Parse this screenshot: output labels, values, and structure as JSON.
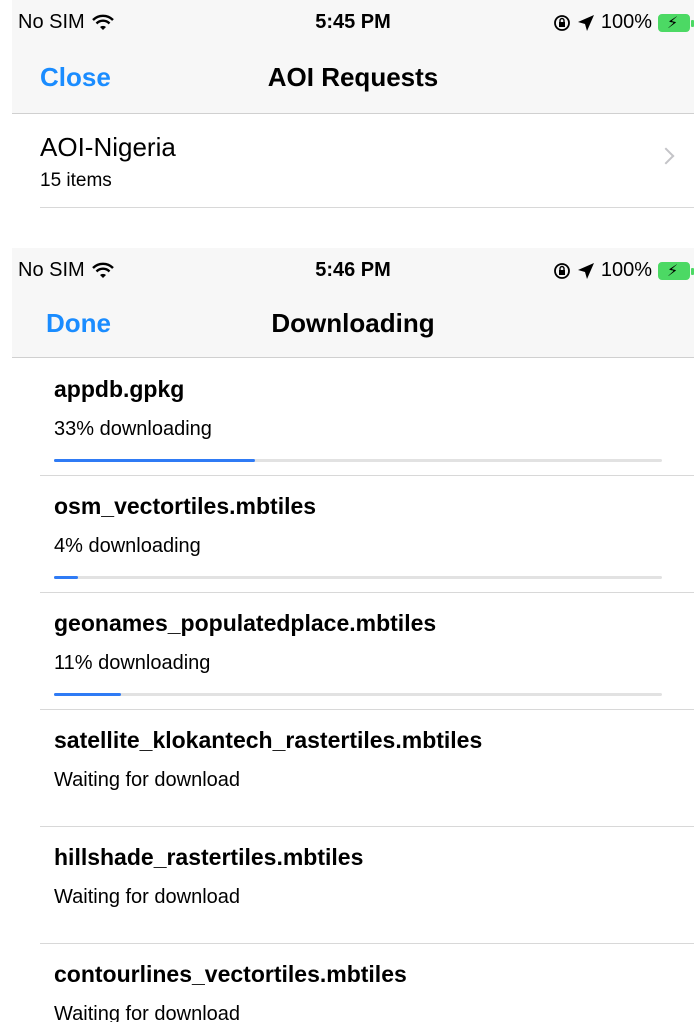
{
  "background_sheet": {
    "status_bar": {
      "carrier": "No SIM",
      "time": "5:45 PM",
      "battery": "100%"
    },
    "nav": {
      "left_button": "Close",
      "title": "AOI Requests"
    },
    "aoi_row": {
      "name": "AOI-Nigeria",
      "count": "15 items"
    }
  },
  "downloading_sheet": {
    "status_bar": {
      "carrier": "No SIM",
      "time": "5:46 PM",
      "battery": "100%"
    },
    "nav": {
      "left_button": "Done",
      "title": "Downloading"
    },
    "items": [
      {
        "name": "appdb.gpkg",
        "status": "33% downloading",
        "progress": 0.33
      },
      {
        "name": "osm_vectortiles.mbtiles",
        "status": "4% downloading",
        "progress": 0.04
      },
      {
        "name": "geonames_populatedplace.mbtiles",
        "status": "11% downloading",
        "progress": 0.11
      },
      {
        "name": "satellite_klokantech_rastertiles.mbtiles",
        "status": "Waiting for download",
        "progress": null
      },
      {
        "name": "hillshade_rastertiles.mbtiles",
        "status": "Waiting for download",
        "progress": null
      },
      {
        "name": "contourlines_vectortiles.mbtiles",
        "status": "Waiting for download",
        "progress": null
      }
    ]
  },
  "colors": {
    "accent": "#1a8cff",
    "progress": "#2f7bf5",
    "battery": "#4cd964"
  },
  "icons": [
    "wifi-icon",
    "orientation-lock-icon",
    "location-arrow-icon",
    "battery-icon",
    "chevron-right-icon"
  ]
}
